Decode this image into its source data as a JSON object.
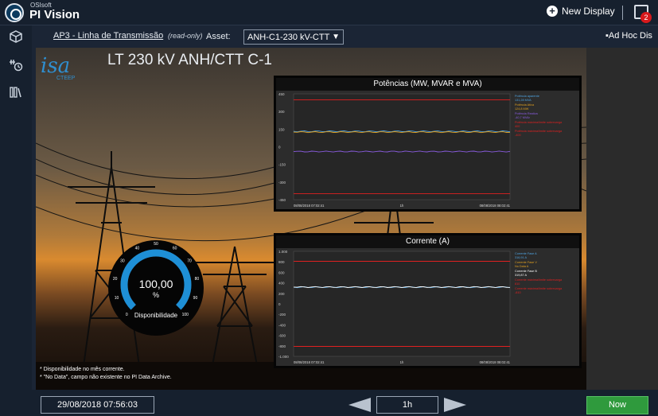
{
  "header": {
    "vendor": "OSIsoft",
    "product": "PI Vision",
    "new_display": "New Display",
    "notification_count": "2"
  },
  "subbar": {
    "breadcrumb": "AP3 - Linha de Transmissão",
    "readonly": "(read-only)",
    "asset_label": "Asset:",
    "asset_value": "ANH-C1-230 kV-CTT",
    "adhoc": "Ad Hoc Dis"
  },
  "display": {
    "title": "LT 230 kV ANH/CTT C-1",
    "logo_text": "isa",
    "logo_sub": "CTEEP",
    "notes": [
      "* Disponibilidade no mês corrente.",
      "* \"No Data\", campo não existente no PI Data Archive."
    ]
  },
  "gauge": {
    "value_text": "100,00",
    "unit": "%",
    "label": "Disponibilidade",
    "value": 100,
    "ticks": [
      "0",
      "10",
      "20",
      "30",
      "40",
      "50",
      "60",
      "70",
      "80",
      "90",
      "100"
    ]
  },
  "power_chart": {
    "title": "Potências (MW, MVAR e MVA)",
    "y_ticks": [
      "450",
      "300",
      "150",
      "0",
      "-150",
      "-300",
      "-450"
    ],
    "x_start": "08/08/2018 07:02:41",
    "x_mid": "1h",
    "x_end": "08/08/2018 08:02:41",
    "legend": [
      {
        "name": "Potência aparente",
        "value": "131,28 MVA",
        "color": "#4fa3e0"
      },
      {
        "name": "Potência Ativa",
        "value": "124,8 MW",
        "color": "#e0a020"
      },
      {
        "name": "Potência Reativa",
        "value": "-40,7 MVAr",
        "color": "#8a5ce0"
      },
      {
        "name": "Potência máxima/limite sobrecarga",
        "value": "400",
        "color": "#e02020"
      },
      {
        "name": "Potência máxima/limite sobrecarga",
        "value": "-400",
        "color": "#e02020"
      }
    ]
  },
  "current_chart": {
    "title": "Corrente (A)",
    "y_ticks": [
      "1.000",
      "800",
      "600",
      "400",
      "200",
      "0",
      "-200",
      "-400",
      "-600",
      "-800",
      "-1.000"
    ],
    "x_start": "08/08/2018 07:02:41",
    "x_mid": "1h",
    "x_end": "08/08/2018 08:02:41",
    "legend": [
      {
        "name": "Corrente Fase A",
        "value": "316,91 A",
        "color": "#4fa3e0"
      },
      {
        "name": "Corrente Fase V",
        "value": "No Data A",
        "color": "#e0a020"
      },
      {
        "name": "Corrente Fase B",
        "value": "319,87 A",
        "color": "#ffffff"
      },
      {
        "name": "Corrente máxima/limite sobrecarga",
        "value": "810",
        "color": "#e02020"
      },
      {
        "name": "Corrente máxima/limite sobrecarga",
        "value": "-810",
        "color": "#e02020"
      }
    ]
  },
  "chart_data": [
    {
      "type": "line",
      "title": "Potências (MW, MVAR e MVA)",
      "ylim": [
        -450,
        450
      ],
      "x": [
        "08/08/2018 07:02:41",
        "08/08/2018 08:02:41"
      ],
      "series": [
        {
          "name": "Potência aparente",
          "values": [
            131.28,
            131.28
          ],
          "color": "#4fa3e0"
        },
        {
          "name": "Potência Ativa",
          "values": [
            124.8,
            124.8
          ],
          "color": "#e0a020"
        },
        {
          "name": "Potência Reativa",
          "values": [
            -40.7,
            -40.7
          ],
          "color": "#8a5ce0"
        },
        {
          "name": "Potência máxima/limite sobrecarga",
          "values": [
            400,
            400
          ],
          "color": "#e02020"
        },
        {
          "name": "Potência máxima/limite sobrecarga",
          "values": [
            -400,
            -400
          ],
          "color": "#e02020"
        }
      ]
    },
    {
      "type": "line",
      "title": "Corrente (A)",
      "ylim": [
        -1000,
        1000
      ],
      "x": [
        "08/08/2018 07:02:41",
        "08/08/2018 08:02:41"
      ],
      "series": [
        {
          "name": "Corrente Fase A",
          "values": [
            316.91,
            316.91
          ],
          "color": "#4fa3e0"
        },
        {
          "name": "Corrente Fase B",
          "values": [
            319.87,
            319.87
          ],
          "color": "#ffffff"
        },
        {
          "name": "Corrente máxima/limite sobrecarga",
          "values": [
            810,
            810
          ],
          "color": "#e02020"
        },
        {
          "name": "Corrente máxima/limite sobrecarga",
          "values": [
            -810,
            -810
          ],
          "color": "#e02020"
        }
      ]
    }
  ],
  "footer": {
    "datetime": "29/08/2018 07:56:03",
    "duration": "1h",
    "now": "Now"
  }
}
